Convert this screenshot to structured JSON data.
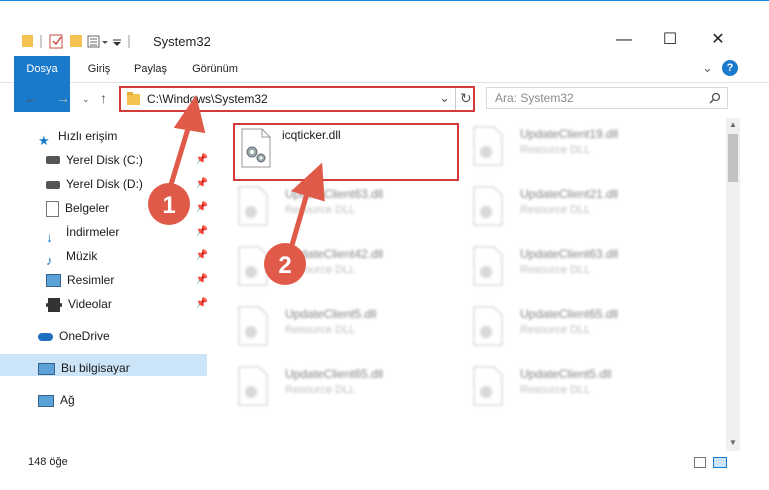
{
  "window": {
    "title": "System32",
    "minimize": "—",
    "maximize": "☐",
    "close": "✕"
  },
  "ribbon": {
    "tabs": [
      "Dosya",
      "Giriş",
      "Paylaş",
      "Görünüm"
    ],
    "help": "?",
    "expand": "⌄"
  },
  "address": {
    "path": "C:\\Windows\\System32",
    "dropdown": "⌄",
    "refresh": "↻"
  },
  "search": {
    "placeholder": "Ara: System32",
    "icon": "search-icon"
  },
  "nav": {
    "items": [
      {
        "label": "Hızlı erişim",
        "icon": "star-icon",
        "pinned": false
      },
      {
        "label": "Yerel Disk (C:)",
        "icon": "drive-icon",
        "pinned": true
      },
      {
        "label": "Yerel Disk (D:)",
        "icon": "drive-icon",
        "pinned": true
      },
      {
        "label": "Belgeler",
        "icon": "documents-icon",
        "pinned": true
      },
      {
        "label": "İndirmeler",
        "icon": "downloads-icon",
        "pinned": true
      },
      {
        "label": "Müzik",
        "icon": "music-icon",
        "pinned": true
      },
      {
        "label": "Resimler",
        "icon": "pictures-icon",
        "pinned": true
      },
      {
        "label": "Videolar",
        "icon": "videos-icon",
        "pinned": true
      },
      {
        "label": "OneDrive",
        "icon": "cloud-icon",
        "pinned": false
      },
      {
        "label": "Bu bilgisayar",
        "icon": "computer-icon",
        "pinned": false,
        "selected": true
      },
      {
        "label": "Ağ",
        "icon": "network-icon",
        "pinned": false
      }
    ]
  },
  "files": {
    "highlighted": {
      "name": "icqticker.dll"
    },
    "column1": [
      {
        "name": "UpdateClient63.dll",
        "type": "Resource DLL"
      },
      {
        "name": "UpdateClient42.dll",
        "type": "Resource DLL"
      },
      {
        "name": "UpdateClient5.dll",
        "type": "Resource DLL"
      },
      {
        "name": "UpdateClient65.dll",
        "type": "Resource DLL"
      }
    ],
    "column2": [
      {
        "name": "UpdateClient19.dll",
        "type": "Resource DLL"
      },
      {
        "name": "UpdateClient21.dll",
        "type": "Resource DLL"
      },
      {
        "name": "UpdateClient63.dll",
        "type": "Resource DLL"
      },
      {
        "name": "UpdateClient65.dll",
        "type": "Resource DLL"
      },
      {
        "name": "UpdateClient5.dll",
        "type": "Resource DLL"
      }
    ]
  },
  "status": {
    "count": "148 öğe"
  },
  "callouts": {
    "one": "1",
    "two": "2",
    "color": "#e05a4a"
  },
  "colors": {
    "accent": "#1979ca",
    "highlight": "#d43a3a"
  }
}
